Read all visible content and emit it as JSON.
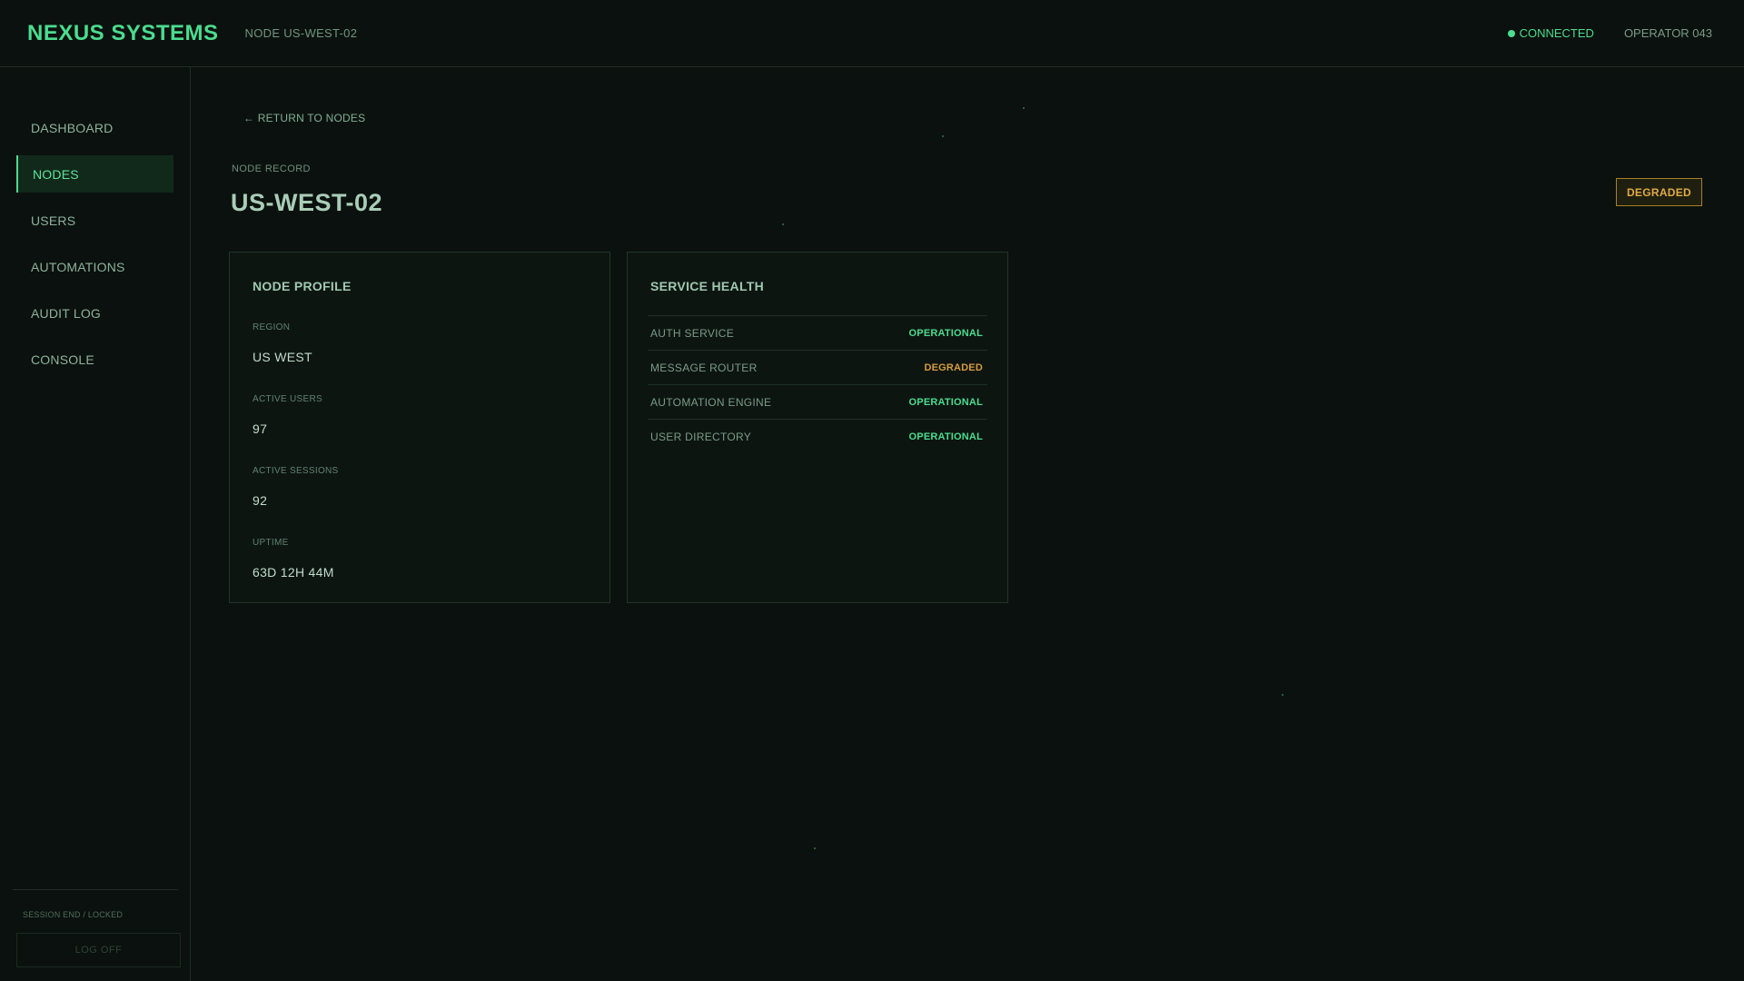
{
  "header": {
    "brand": "NEXUS SYSTEMS",
    "node_tag": "NODE US-WEST-02",
    "connection_status": "CONNECTED",
    "operator": "OPERATOR 043"
  },
  "sidebar": {
    "items": [
      {
        "label": "DASHBOARD",
        "active": false
      },
      {
        "label": "NODES",
        "active": true
      },
      {
        "label": "USERS",
        "active": false
      },
      {
        "label": "AUTOMATIONS",
        "active": false
      },
      {
        "label": "AUDIT LOG",
        "active": false
      },
      {
        "label": "CONSOLE",
        "active": false
      }
    ],
    "session_note": "SESSION END / LOCKED",
    "logoff_label": "LOG OFF"
  },
  "main": {
    "return_link": "← RETURN TO NODES",
    "record_label": "NODE RECORD",
    "node_title": "US-WEST-02",
    "status_badge": "DEGRADED",
    "profile": {
      "title": "NODE PROFILE",
      "fields": [
        {
          "label": "REGION",
          "value": "US WEST"
        },
        {
          "label": "ACTIVE USERS",
          "value": "97"
        },
        {
          "label": "ACTIVE SESSIONS",
          "value": "92"
        },
        {
          "label": "UPTIME",
          "value": "63D 12H 44M"
        }
      ]
    },
    "health": {
      "title": "SERVICE HEALTH",
      "services": [
        {
          "name": "AUTH SERVICE",
          "status": "OPERATIONAL",
          "state": "ok"
        },
        {
          "name": "MESSAGE ROUTER",
          "status": "DEGRADED",
          "state": "degraded"
        },
        {
          "name": "AUTOMATION ENGINE",
          "status": "OPERATIONAL",
          "state": "ok"
        },
        {
          "name": "USER DIRECTORY",
          "status": "OPERATIONAL",
          "state": "ok"
        }
      ]
    }
  },
  "colors": {
    "accent": "#4bdc8f",
    "warning": "#e0aa47",
    "background": "#0b110e"
  }
}
